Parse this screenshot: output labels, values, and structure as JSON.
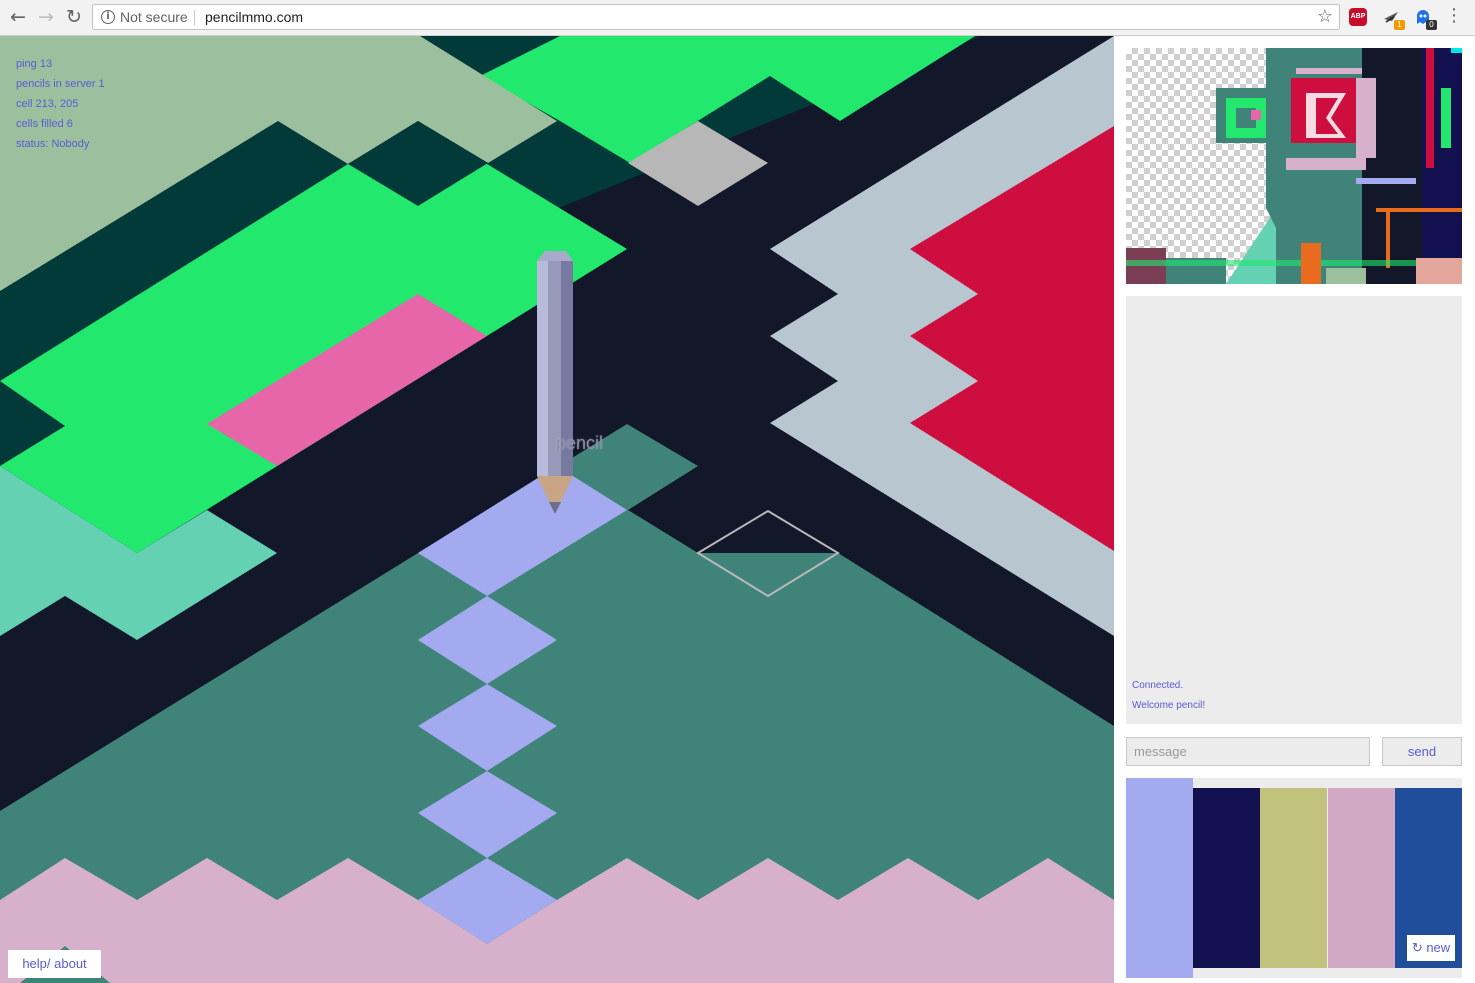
{
  "browser": {
    "security_label": "Not secure",
    "url": "pencilmmo.com",
    "extensions": [
      {
        "name": "adblock",
        "label": "ABP"
      },
      {
        "name": "extension-two",
        "badge": "1",
        "badge_color": "#f29900"
      },
      {
        "name": "extension-three",
        "badge": "0",
        "badge_color": "#333333"
      }
    ]
  },
  "stats": {
    "ping": "ping 13",
    "pencils": "pencils in server 1",
    "cell": "cell 213, 205",
    "cells_filled": "cells filled 6",
    "status": "status: Nobody"
  },
  "player": {
    "name": "pencil"
  },
  "help_label": "help/ about",
  "chat": {
    "messages": [
      "Connected.",
      "Welcome pencil!"
    ],
    "placeholder": "message",
    "send_label": "send"
  },
  "palette": {
    "colors": [
      "#a3aaef",
      "#12104e",
      "#c1c27e",
      "#d2a9c4",
      "#214e9b"
    ],
    "selected_index": 0,
    "new_label": "↻ new"
  },
  "theme": {
    "accent": "#5b5bd6",
    "board_colors": {
      "navy": "#121729",
      "dark_green": "#013a39",
      "green": "#22e86e",
      "sage": "#9cc09e",
      "pink": "#e766a9",
      "mint": "#63d1b2",
      "teal": "#408479",
      "lilac": "#a3aaef",
      "lightblue": "#b8c7cf",
      "red": "#cd0e3e",
      "grey": "#b7b7b7",
      "mauve": "#d7b1cb"
    }
  }
}
